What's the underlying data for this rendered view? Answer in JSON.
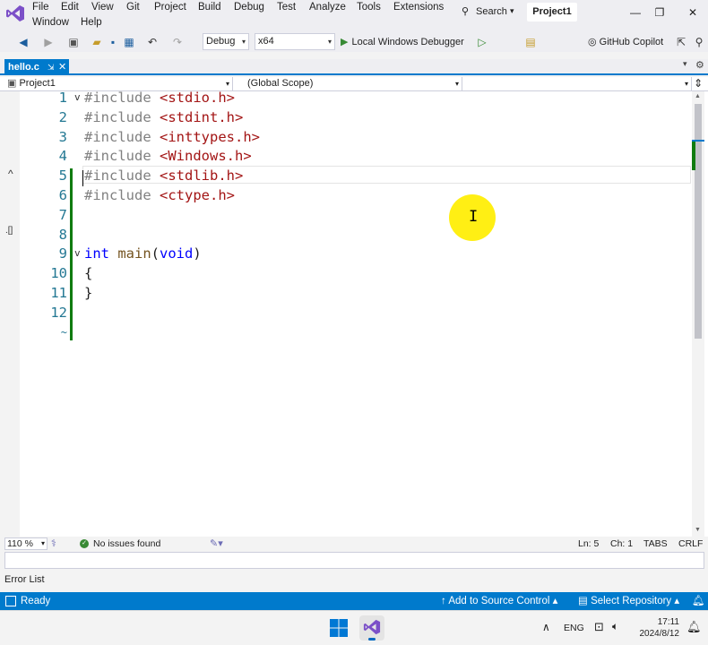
{
  "menu": {
    "items": [
      "File",
      "Edit",
      "View",
      "Git",
      "Project",
      "Build",
      "Debug",
      "Test",
      "Analyze",
      "Tools",
      "Extensions"
    ],
    "items_row2": [
      "Window",
      "Help"
    ],
    "search_label": "Search",
    "project_badge": "Project1"
  },
  "toolbar": {
    "configuration": "Debug",
    "platform": "x64",
    "debugger_label": "Local Windows Debugger",
    "copilot_label": "GitHub Copilot"
  },
  "tabs": [
    {
      "label": "hello.c",
      "active": true
    }
  ],
  "navbar": {
    "project": "Project1",
    "scope": "(Global Scope)",
    "member": ""
  },
  "editor": {
    "lines": [
      {
        "num": "1",
        "text": "#include <stdio.h>",
        "fold": "v"
      },
      {
        "num": "2",
        "text": "#include <stdint.h>",
        "fold": ""
      },
      {
        "num": "3",
        "text": "#include <inttypes.h>",
        "fold": ""
      },
      {
        "num": "4",
        "text": "#include <Windows.h>",
        "fold": ""
      },
      {
        "num": "5",
        "text": "#include <stdlib.h>",
        "fold": ""
      },
      {
        "num": "6",
        "text": "#include <ctype.h>",
        "fold": ""
      },
      {
        "num": "7",
        "text": "",
        "fold": ""
      },
      {
        "num": "8",
        "text": "",
        "fold": ""
      },
      {
        "num": "9",
        "text": "int main(void)",
        "fold": "v"
      },
      {
        "num": "10",
        "text": "{",
        "fold": ""
      },
      {
        "num": "11",
        "text": "}",
        "fold": ""
      },
      {
        "num": "12",
        "text": "",
        "fold": ""
      }
    ],
    "current_line": 5,
    "end_marker": "~",
    "gutter_caret": "^",
    "gutter_marker": ".[]"
  },
  "status": {
    "zoom": "110 %",
    "issues": "No issues found",
    "line": "Ln: 5",
    "col": "Ch: 1",
    "indent": "TABS",
    "eol": "CRLF"
  },
  "error_list_tab": "Error List",
  "statusbar": {
    "ready": "Ready",
    "source_control": "Add to Source Control",
    "select_repo": "Select Repository"
  },
  "taskbar": {
    "lang": "ENG",
    "time": "17:11",
    "date": "2024/8/12"
  },
  "colors": {
    "accent": "#007acc",
    "change_bar": "#107c10",
    "preprocessor": "#808080",
    "include_string": "#a31515",
    "keyword": "#0000ff",
    "function": "#74531f",
    "pointer_highlight": "#ffee00"
  }
}
